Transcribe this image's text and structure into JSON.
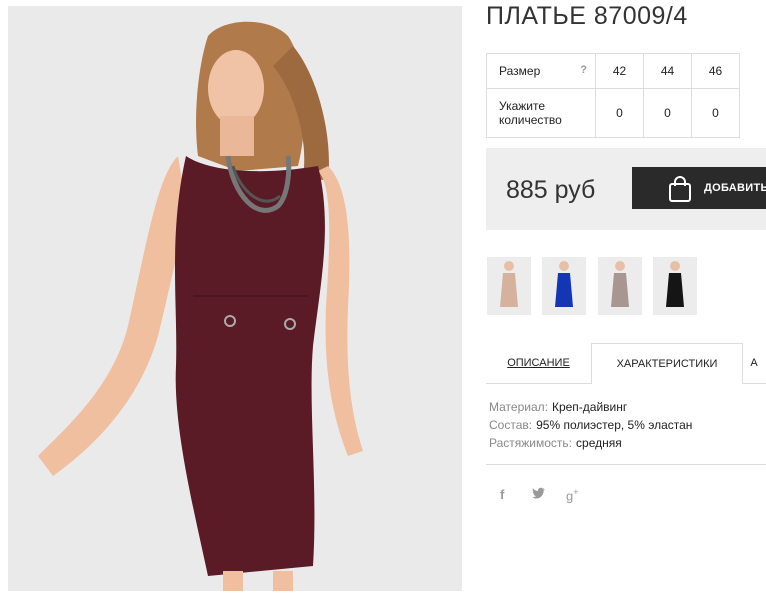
{
  "product": {
    "title": "ПЛАТЬЕ 87009/4",
    "main_image": "woman-in-burgundy-sheath-dress",
    "dress_color": "#5a1a26"
  },
  "size_table": {
    "size_label": "Размер",
    "help_glyph": "?",
    "sizes": [
      "42",
      "44",
      "46"
    ],
    "qty_label_line1": "Укажите",
    "qty_label_line2": "количество",
    "quantities": [
      "0",
      "0",
      "0"
    ]
  },
  "purchase": {
    "price": "885 руб",
    "add_label": "ДОБАВИТЬ",
    "add_icon": "shopping-bag-icon"
  },
  "color_variants": [
    {
      "name": "beige",
      "color": "#d4b29e"
    },
    {
      "name": "blue",
      "color": "#1436b4"
    },
    {
      "name": "grey",
      "color": "#a89690"
    },
    {
      "name": "black",
      "color": "#151515"
    }
  ],
  "tabs": [
    {
      "label": "ОПИСАНИЕ",
      "active": false
    },
    {
      "label": "ХАРАКТЕРИСТИКИ",
      "active": true
    },
    {
      "label": "А",
      "active": false
    }
  ],
  "characteristics": [
    {
      "key": "Материал:",
      "value": "Креп-дайвинг"
    },
    {
      "key": "Состав:",
      "value": "95% полиэстер, 5% эластан"
    },
    {
      "key": "Растяжимость:",
      "value": "средняя"
    }
  ],
  "social": [
    {
      "icon": "facebook-icon",
      "glyph": "f"
    },
    {
      "icon": "twitter-icon",
      "glyph": "🐦"
    },
    {
      "icon": "google-plus-icon",
      "glyph": "g+"
    }
  ]
}
